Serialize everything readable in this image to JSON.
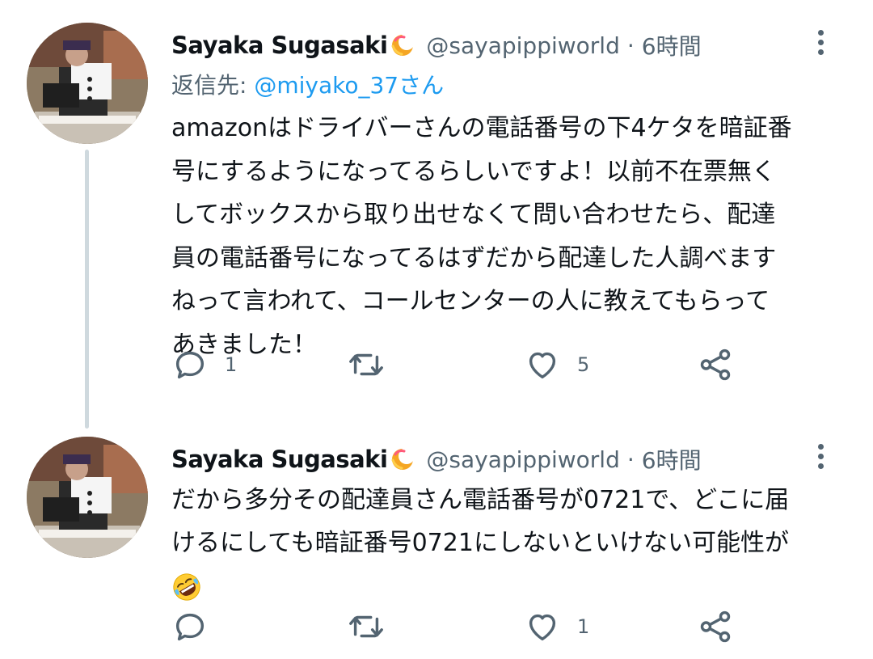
{
  "tweets": [
    {
      "author_name": "Sayaka Sugasaki",
      "handle": "@sayapippiworld",
      "separator": "·",
      "time": "6時間",
      "reply_label": "返信先: ",
      "reply_mention": "@miyako_37さん",
      "text_lines": [
        "amazonはドライバーさんの電話番号の下4ケタを暗証番",
        "号にするようになってるらしいですよ！以前不在票無く",
        "してボックスから取り出せなくて問い合わせたら、配達",
        "員の電話番号になってるはずだから配達した人調べます",
        "ねって言われて、コールセンターの人に教えてもらって",
        "あきました！"
      ],
      "reply_count": "1",
      "retweet_count": "",
      "like_count": "5"
    },
    {
      "author_name": "Sayaka Sugasaki",
      "handle": "@sayapippiworld",
      "separator": "·",
      "time": "6時間",
      "text_lines": [
        "だから多分その配達員さん電話番号が0721で、どこに届",
        "けるにしても暗証番号0721にしないといけない可能性が"
      ],
      "emoji": "rolling-on-floor-laughing",
      "reply_count": "",
      "retweet_count": "",
      "like_count": "1"
    }
  ],
  "colors": {
    "text_primary": "#0f1419",
    "text_secondary": "#536471",
    "accent": "#1d9bf0",
    "thread_line": "#cfd9de"
  },
  "icons": {
    "reply": "reply-icon",
    "retweet": "retweet-icon",
    "like": "heart-icon",
    "share": "share-icon",
    "more": "more-icon",
    "badge": "moon-badge-icon"
  }
}
